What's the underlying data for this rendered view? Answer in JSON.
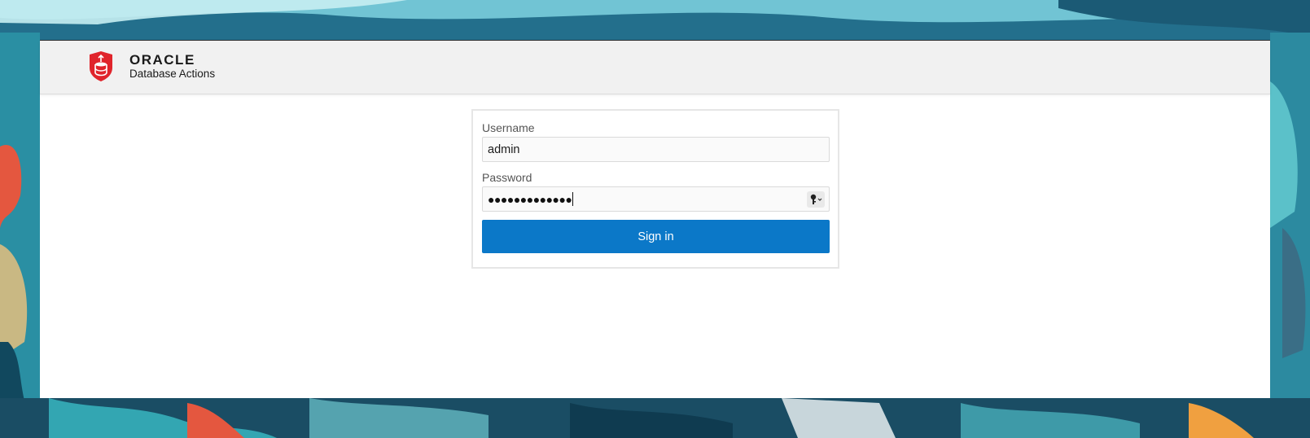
{
  "header": {
    "brand_name": "ORACLE",
    "product_name": "Database Actions",
    "brand_color": "#e0242b"
  },
  "login": {
    "username_label": "Username",
    "username_value": "admin",
    "password_label": "Password",
    "password_masked": "●●●●●●●●●●●●●",
    "sign_in_label": "Sign in",
    "button_color": "#0b78c8"
  },
  "icons": {
    "logo": "oracle-database-shield-icon",
    "password_manager": "key-icon"
  }
}
